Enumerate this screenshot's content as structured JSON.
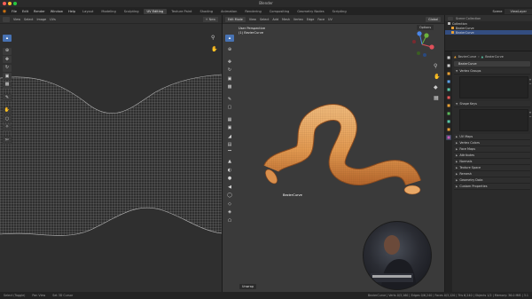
{
  "window": {
    "title": "Blender"
  },
  "menu": {
    "items": [
      "File",
      "Edit",
      "Render",
      "Window",
      "Help"
    ],
    "workspaces": [
      "Layout",
      "Modeling",
      "Sculpting",
      "UV Editing",
      "Texture Paint",
      "Shading",
      "Animation",
      "Rendering",
      "Compositing",
      "Geometry Nodes",
      "Scripting"
    ],
    "active_workspace": "UV Editing",
    "scene": "Scene",
    "view_layer": "ViewLayer"
  },
  "uv_editor": {
    "header": [
      "View",
      "Select",
      "Image",
      "UVs"
    ],
    "image_button": "+ New"
  },
  "viewport": {
    "mode": "Edit Mode",
    "header": [
      "View",
      "Select",
      "Add",
      "Mesh",
      "Vertex",
      "Edge",
      "Face",
      "UV"
    ],
    "transform": "Global",
    "overlay_title": "User Perspective",
    "overlay_object": "(1) BezierCurve",
    "object_label": "BezierCurve",
    "options": "Options",
    "operator_panel": "Unwrap"
  },
  "outliner": {
    "header": "Scene Collection",
    "rows": [
      {
        "label": "Collection",
        "color": "#bbbbbb",
        "selected": false
      },
      {
        "label": "BezierCurve",
        "color": "#e8a034",
        "selected": false
      },
      {
        "label": "BezierCurve",
        "color": "#e8a034",
        "selected": true
      }
    ]
  },
  "properties": {
    "breadcrumb": [
      "BezierCurve",
      "BezierCurve"
    ],
    "name_field": "BezierCurve",
    "list_sections": [
      "Vertex Groups",
      "Shape Keys"
    ],
    "sections": [
      "UV Maps",
      "Vertex Colors",
      "Face Maps",
      "Attributes",
      "Normals",
      "Texture Space",
      "Remesh",
      "Geometry Data",
      "Custom Properties"
    ],
    "tab_colors": [
      "#cccccc",
      "#cccccc",
      "#e8a034",
      "#5aa0e8",
      "#58c8a8",
      "#e85858",
      "#e8a034",
      "#5ab85a",
      "#58c8a8",
      "#e8a034",
      "#c85ab8"
    ]
  },
  "status": {
    "left": [
      "Select (Toggle)",
      "Pan View",
      "Set 3D Cursor"
    ],
    "right": "BezierCurve | Verts 0/3,160 | Edges 0/6,240 | Faces 0/3,120 | Tris 6,240 | Objects 1/2 | Memory: 36.0 MiB | 3.1"
  },
  "colors": {
    "accent": "#4772b3",
    "mesh_orange": "#e8a55a",
    "selected_outline": "#f0a050"
  }
}
